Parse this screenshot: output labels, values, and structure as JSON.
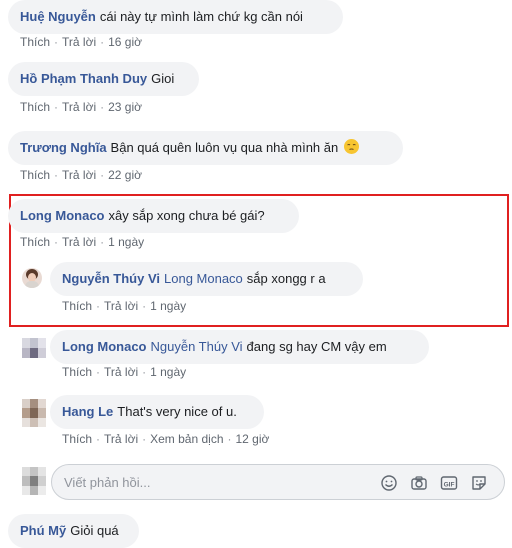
{
  "comments": [
    {
      "name": "Huệ Nguyễn",
      "text": "cái này tự mình làm chứ kg cần nói",
      "like": "Thích",
      "reply": "Trả lời",
      "time": "16 giờ"
    },
    {
      "name": "Hồ Phạm Thanh Duy",
      "text": "Gioi",
      "like": "Thích",
      "reply": "Trả lời",
      "time": "23 giờ"
    },
    {
      "name": "Trương Nghĩa",
      "text": "Bận quá quên luôn vụ qua nhà mình ăn",
      "emoji": "pensive-face",
      "like": "Thích",
      "reply": "Trả lời",
      "time": "22 giờ"
    },
    {
      "name": "Long Monaco",
      "text": "xây sắp xong chưa bé gái?",
      "like": "Thích",
      "reply": "Trả lời",
      "time": "1 ngày"
    },
    {
      "name": "Nguyễn Thúy Vi",
      "mention": "Long Monaco",
      "text": "sắp xongg r a",
      "like": "Thích",
      "reply": "Trả lời",
      "time": "1 ngày"
    },
    {
      "name": "Long Monaco",
      "mention": "Nguyễn Thúy Vi",
      "text": "đang sg hay CM vậy em",
      "like": "Thích",
      "reply": "Trả lời",
      "time": "1 ngày"
    },
    {
      "name": "Hang Le",
      "text": "That's very nice of u.",
      "like": "Thích",
      "reply": "Trả lời",
      "translate": "Xem bản dịch",
      "time": "12 giờ"
    },
    {
      "name": "Phú Mỹ",
      "text": "Giỏi quá"
    }
  ],
  "reply_box": {
    "placeholder": "Viết phản hồi...",
    "icons": [
      "emoji-icon",
      "camera-icon",
      "gif-icon",
      "sticker-icon"
    ]
  },
  "colors": {
    "name": "#385898",
    "bubble": "#f2f3f5",
    "highlight": "#e02020",
    "meta": "#606770"
  }
}
